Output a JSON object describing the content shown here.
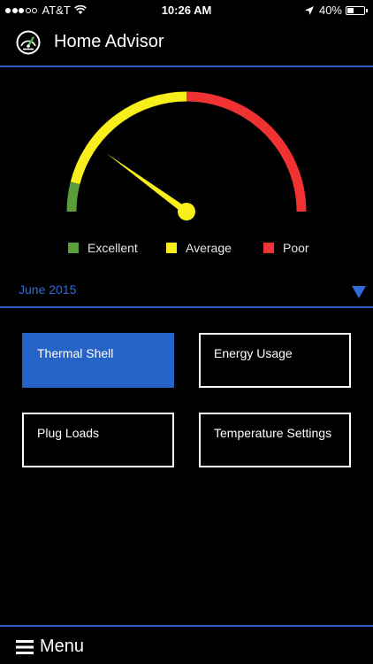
{
  "status_bar": {
    "carrier": "AT&T",
    "time": "10:26 AM",
    "battery": "40%",
    "battery_level": 0.4
  },
  "header": {
    "title": "Home Advisor",
    "logo_icon": "gauge-icon"
  },
  "gauge": {
    "needle_value": 0.2,
    "segments": [
      {
        "name": "Excellent",
        "color": "#5a9e3c",
        "from": 0.0,
        "to": 0.08
      },
      {
        "name": "Average",
        "color": "#f7ee1c",
        "from": 0.08,
        "to": 0.5
      },
      {
        "name": "Poor",
        "color": "#f03232",
        "from": 0.5,
        "to": 1.0
      }
    ],
    "needle_color": "#f7ee1c"
  },
  "legend": {
    "items": [
      {
        "label": "Excellent",
        "color": "#5a9e3c"
      },
      {
        "label": "Average",
        "color": "#f7ee1c"
      },
      {
        "label": "Poor",
        "color": "#f03232"
      }
    ]
  },
  "date_selector": {
    "label": "June 2015"
  },
  "categories": [
    {
      "label": "Thermal Shell",
      "active": true
    },
    {
      "label": "Energy Usage",
      "active": false
    },
    {
      "label": "Plug Loads",
      "active": false
    },
    {
      "label": "Temperature Settings",
      "active": false
    }
  ],
  "footer": {
    "menu_label": "Menu"
  },
  "colors": {
    "accent": "#2563c6",
    "divider": "#2b5fc9",
    "background": "#000000"
  }
}
